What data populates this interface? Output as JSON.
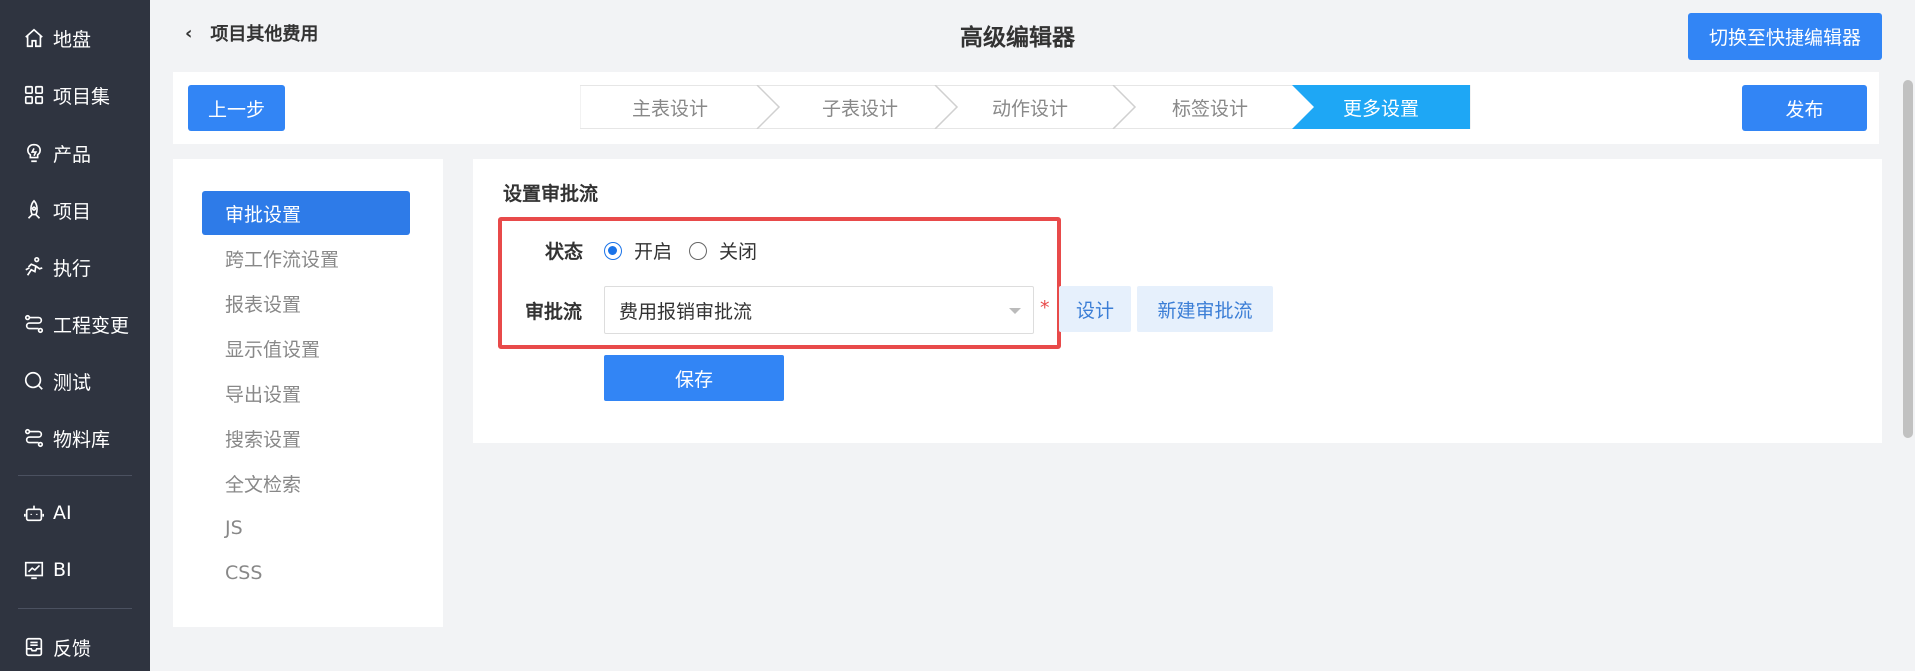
{
  "nav": {
    "items": [
      {
        "label": "地盘",
        "icon": "home-icon"
      },
      {
        "label": "项目集",
        "icon": "grid-icon"
      },
      {
        "label": "产品",
        "icon": "bulb-icon"
      },
      {
        "label": "项目",
        "icon": "rocket-icon"
      },
      {
        "label": "执行",
        "icon": "run-icon"
      },
      {
        "label": "工程变更",
        "icon": "flow-icon"
      },
      {
        "label": "测试",
        "icon": "magnifier-icon"
      },
      {
        "label": "物料库",
        "icon": "flow-icon"
      },
      {
        "label": "AI",
        "icon": "robot-icon"
      },
      {
        "label": "BI",
        "icon": "chart-icon"
      },
      {
        "label": "反馈",
        "icon": "inbox-icon"
      }
    ]
  },
  "header": {
    "back_label": "项目其他费用",
    "title": "高级编辑器",
    "switch_label": "切换至快捷编辑器"
  },
  "steps": {
    "prev_label": "上一步",
    "publish_label": "发布",
    "items": [
      "主表设计",
      "子表设计",
      "动作设计",
      "标签设计",
      "更多设置"
    ],
    "active_index": 4,
    "active_color": "#1ea7f5"
  },
  "side": {
    "items": [
      "审批设置",
      "跨工作流设置",
      "报表设置",
      "显示值设置",
      "导出设置",
      "搜索设置",
      "全文检索",
      "JS",
      "CSS"
    ],
    "active_index": 0
  },
  "form": {
    "section_title": "设置审批流",
    "status_label": "状态",
    "radio_on": "开启",
    "radio_off": "关闭",
    "status_value": "开启",
    "flow_label": "审批流",
    "flow_value": "费用报销审批流",
    "required_mark": "*",
    "design_label": "设计",
    "new_flow_label": "新建审批流",
    "save_label": "保存"
  },
  "colors": {
    "primary": "#3285f5",
    "highlight_border": "#e84a4a",
    "nav_bg": "#2f3440"
  }
}
